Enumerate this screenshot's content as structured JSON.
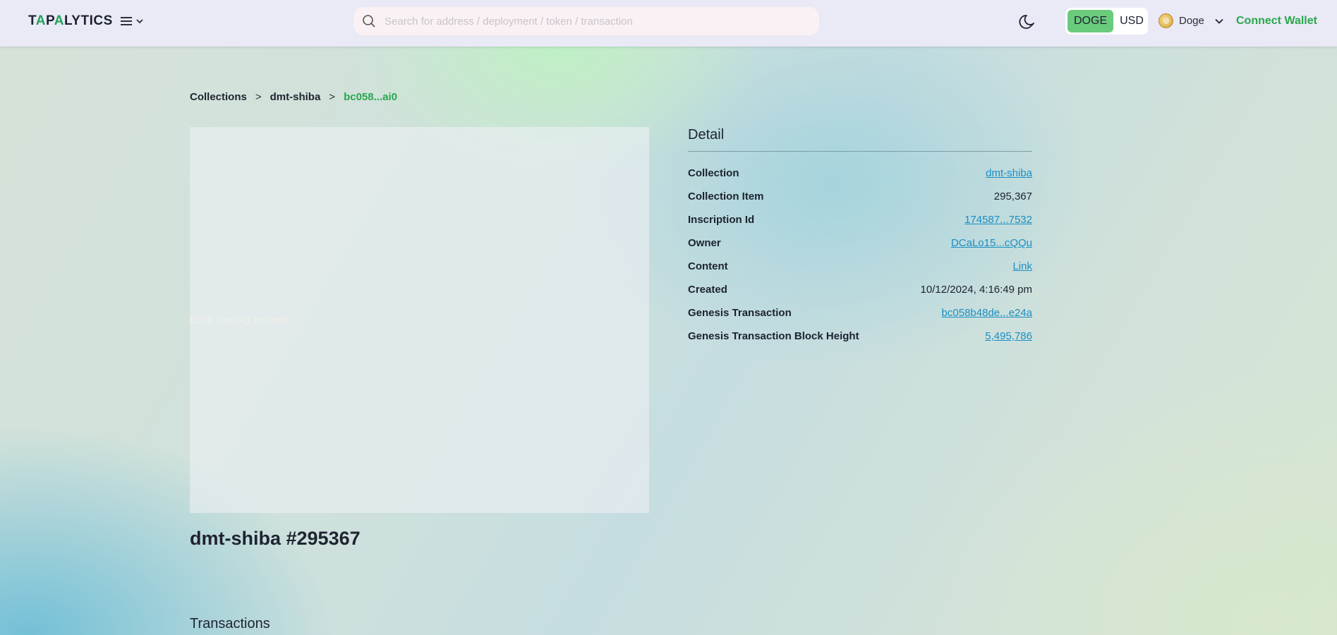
{
  "header": {
    "logo_parts": [
      "T",
      "A",
      "P",
      "A",
      "LYTICS"
    ],
    "search": {
      "placeholder": "Search for address / deployment / token / transaction",
      "value": ""
    },
    "currency": {
      "options": [
        "DOGE",
        "USD"
      ],
      "active": "DOGE"
    },
    "network": {
      "label": "Doge"
    },
    "connect_label": "Connect Wallet",
    "colors": {
      "accent": "#2aa74d",
      "currency_active": "#6bcb7c",
      "link": "#1a8fc4"
    }
  },
  "breadcrumb": {
    "items": [
      "Collections",
      "dmt-shiba"
    ],
    "current": "bc058...ai0",
    "separator": ">"
  },
  "preview": {
    "error_text": "Error loading content"
  },
  "item": {
    "title": "dmt-shiba #295367"
  },
  "detail": {
    "title": "Detail",
    "rows": [
      {
        "label": "Collection",
        "value": "dmt-shiba",
        "link": true
      },
      {
        "label": "Collection Item",
        "value": "295,367",
        "link": false
      },
      {
        "label": "Inscription Id",
        "value": "174587...7532",
        "link": true
      },
      {
        "label": "Owner",
        "value": "DCaLo15...cQQu",
        "link": true
      },
      {
        "label": "Content",
        "value": "Link",
        "link": true
      },
      {
        "label": "Created",
        "value": "10/12/2024, 4:16:49 pm",
        "link": false
      },
      {
        "label": "Genesis Transaction",
        "value": "bc058b48de...e24a",
        "link": true
      },
      {
        "label": "Genesis Transaction Block Height",
        "value": "5,495,786",
        "link": true
      }
    ]
  },
  "transactions": {
    "title": "Transactions"
  }
}
